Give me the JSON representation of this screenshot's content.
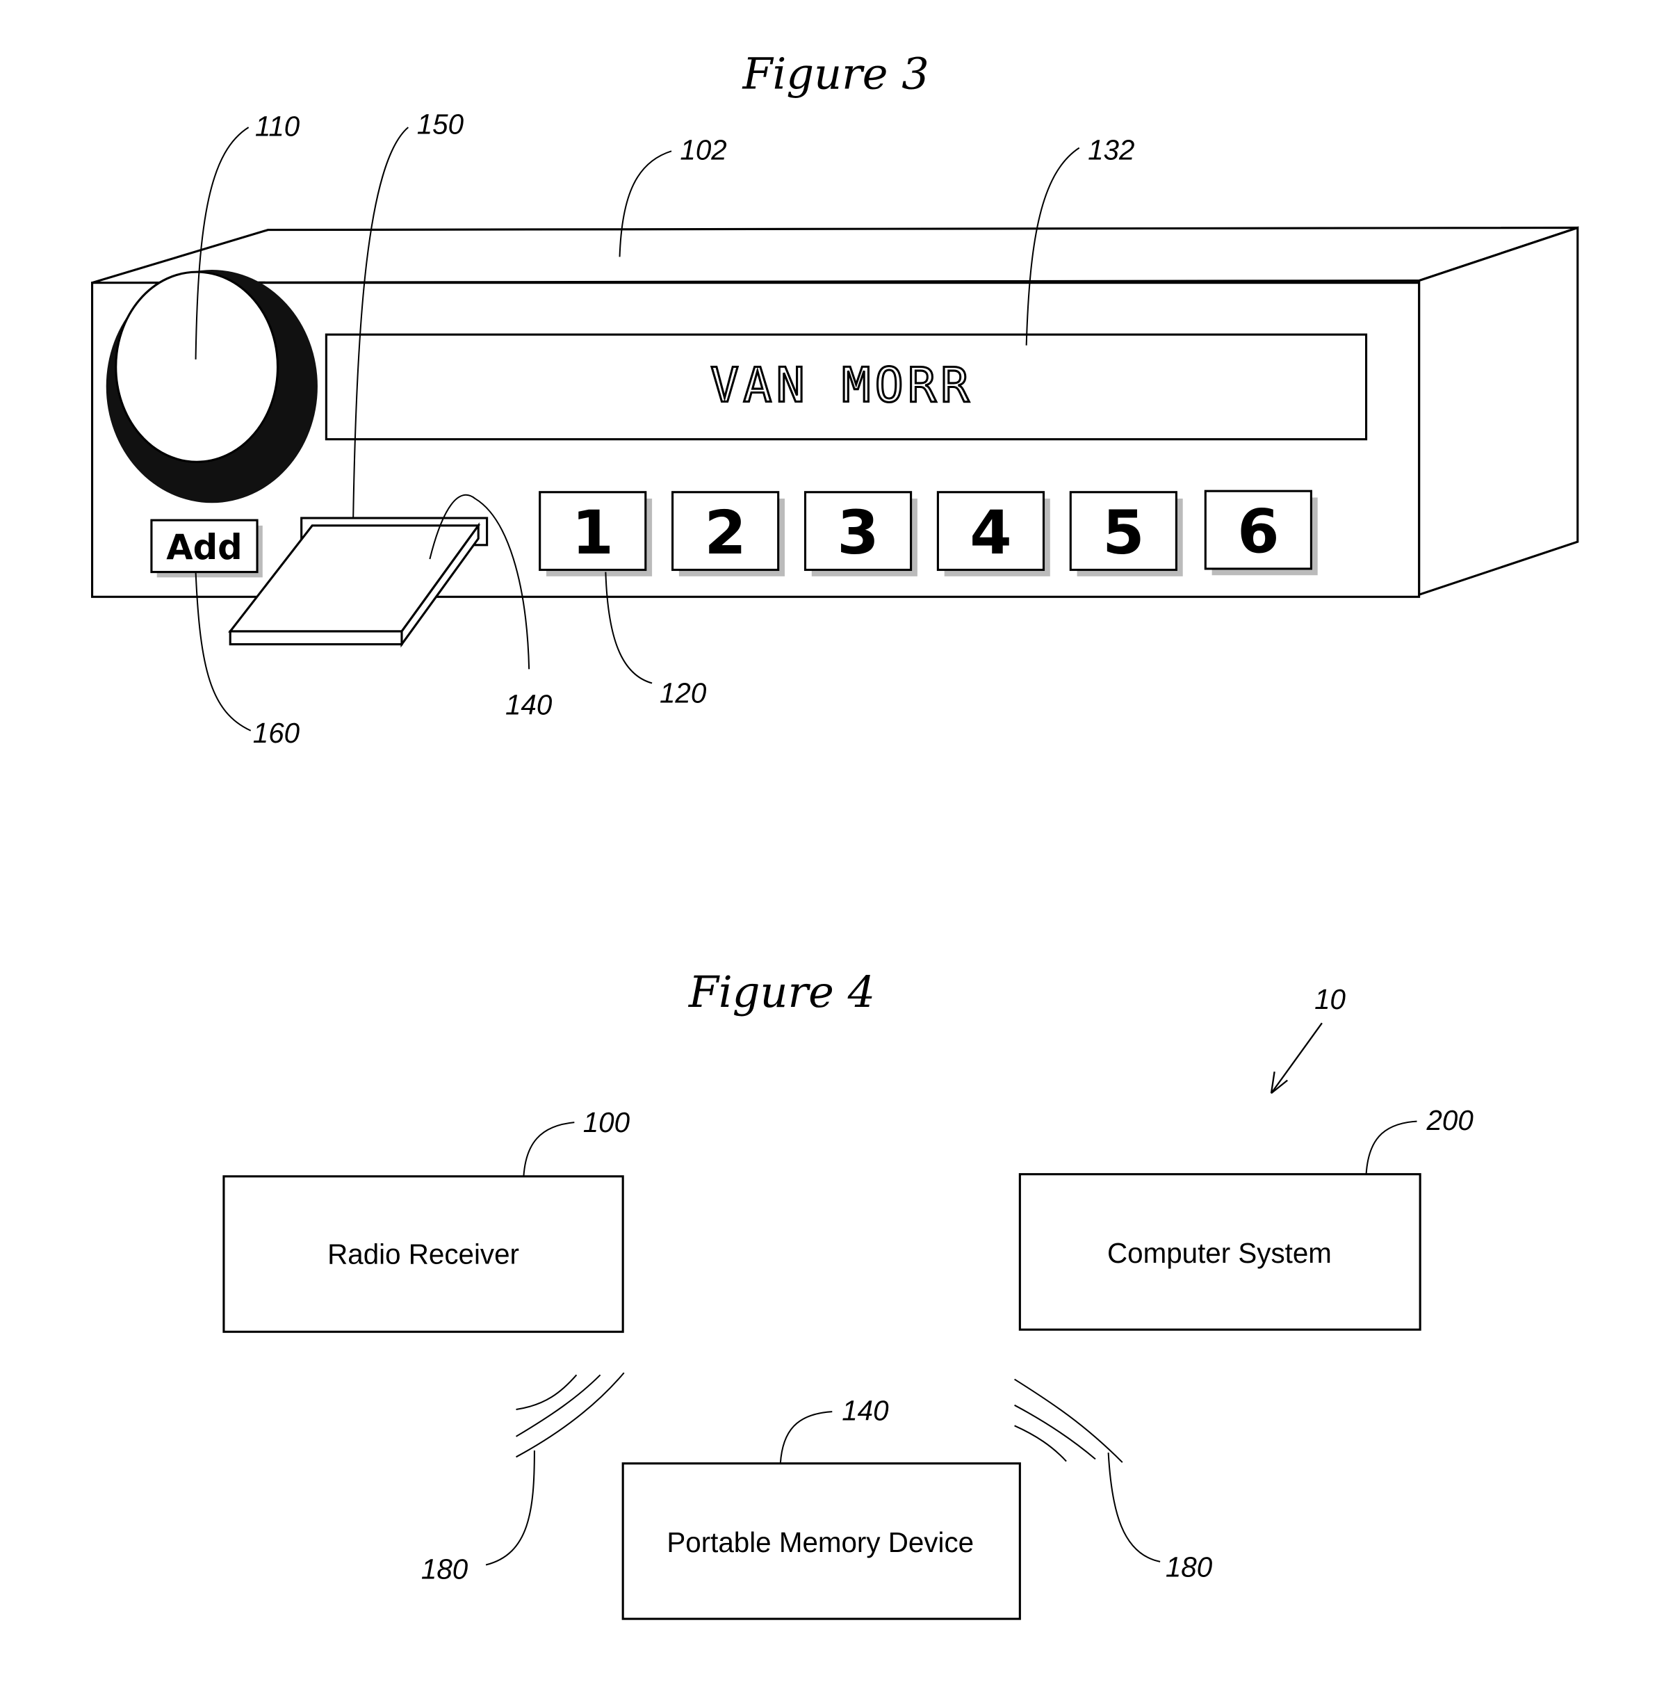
{
  "figure3": {
    "title": "Figure 3",
    "display_text": "VAN MORR",
    "add_button_label": "Add",
    "preset_buttons": [
      "1",
      "2",
      "3",
      "4",
      "5",
      "6"
    ],
    "refs": {
      "knob": "110",
      "slot": "150",
      "housing": "102",
      "display": "132",
      "add_button": "160",
      "memory_card": "140",
      "preset": "120"
    }
  },
  "figure4": {
    "title": "Figure 4",
    "system_ref": "10",
    "blocks": {
      "radio_receiver": {
        "label": "Radio Receiver",
        "ref": "100"
      },
      "computer_system": {
        "label": "Computer System",
        "ref": "200"
      },
      "portable_memory": {
        "label": "Portable Memory Device",
        "ref": "140"
      }
    },
    "wireless_ref_left": "180",
    "wireless_ref_right": "180"
  }
}
